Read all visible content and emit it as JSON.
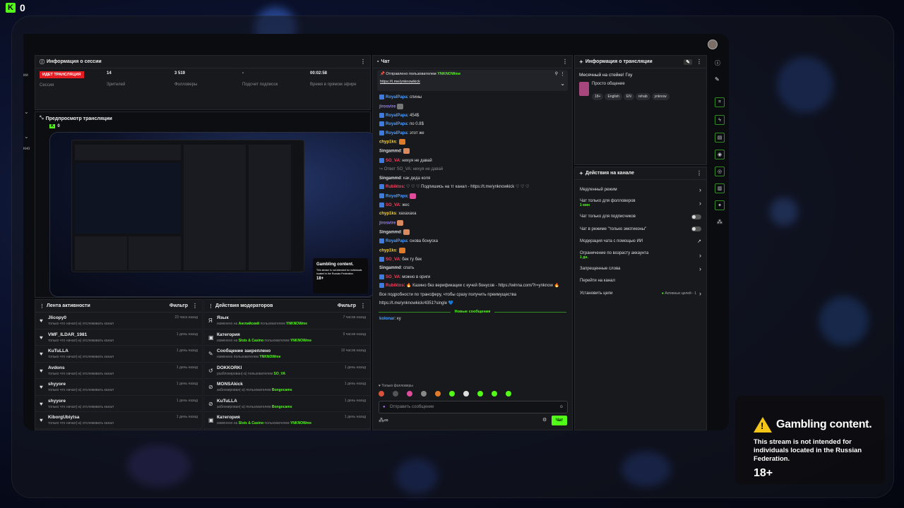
{
  "topbar": {
    "logo_letter": "K",
    "viewer_count": "0"
  },
  "session": {
    "title": "Информация о сессии",
    "status_badge": "ИДЕТ ТРАНСЛЯЦИЯ",
    "session_label": "Сессия",
    "viewers": "14",
    "viewers_label": "Зрителей",
    "followers": "3 519",
    "followers_label": "Фолловеры",
    "subs": "-",
    "subs_label": "Подсчет подписок",
    "uptime": "00:02:58",
    "uptime_label": "Время в прямом эфире"
  },
  "preview": {
    "title": "Предпросмотр трансляции",
    "logo": "K",
    "count": "0",
    "overlay_title": "Gambling content.",
    "overlay_desc": "This stream is not intended for individuals located in the Russian Federation.",
    "overlay_age": "18+"
  },
  "activity": {
    "title": "Лента активности",
    "filter": "Фильтр",
    "items": [
      {
        "name": "Jlicopy0",
        "sub": "только что начал(-а) отслеживать канал",
        "time": "23 часа назад"
      },
      {
        "name": "VMF_ILDAR_1981",
        "sub": "только что начал(-а) отслеживать канал",
        "time": "1 день назад"
      },
      {
        "name": "KuTuLLA",
        "sub": "только что начал(-а) отслеживать канал",
        "time": "1 день назад"
      },
      {
        "name": "Avdons",
        "sub": "только что начал(-а) отслеживать канал",
        "time": "1 день назад"
      },
      {
        "name": "shyyore",
        "sub": "только что начал(-а) отслеживать канал",
        "time": "1 день назад"
      },
      {
        "name": "shyyore",
        "sub": "только что начал(-а) отслеживать канал",
        "time": "1 день назад"
      },
      {
        "name": "KiborgUbiytsa",
        "sub": "только что начал(-а) отслеживать канал",
        "time": "1 день назад"
      }
    ]
  },
  "modactions": {
    "title": "Действия модераторов",
    "filter": "Фильтр",
    "items": [
      {
        "icon": "Я",
        "name": "Язык",
        "pre": "изменено на ",
        "hl1": "Английский",
        "mid": " пользователем ",
        "hl2": "YNKNOWme",
        "time": "7 часов назад"
      },
      {
        "icon": "▣",
        "name": "Категория",
        "pre": "изменено на ",
        "hl1": "Slots & Casino",
        "mid": " пользователем ",
        "hl2": "YNKNOWme",
        "time": "9 часов назад"
      },
      {
        "icon": "✎",
        "name": "Сообщение закреплено",
        "pre": "",
        "hl1": "",
        "mid": "изменено пользователем ",
        "hl2": "YNKNOWme",
        "time": "10 часов назад"
      },
      {
        "icon": "↺",
        "name": "DOKKORKI",
        "pre": "",
        "hl1": "",
        "mid": "разблокирован(-а) пользователем ",
        "hl2": "SO_VA",
        "time": "1 день назад"
      },
      {
        "icon": "⊘",
        "name": "MONSAkick",
        "pre": "",
        "hl1": "",
        "mid": "заблокирован(-а) пользователем ",
        "hl2": "Bongocams",
        "time": "1 день назад"
      },
      {
        "icon": "⊘",
        "name": "KuTuLLA",
        "pre": "",
        "hl1": "",
        "mid": "заблокирован(-а) пользователем ",
        "hl2": "Bongocams",
        "time": "1 день назад"
      },
      {
        "icon": "▣",
        "name": "Категория",
        "pre": "изменено на ",
        "hl1": "Slots & Casino",
        "mid": " пользователем ",
        "hl2": "YNKNOWme",
        "time": "1 день назад"
      }
    ]
  },
  "chat": {
    "title": "Чат",
    "pinned_by": "Отправлено пользователем",
    "pinned_user": "YNKNOWme",
    "pinned_link": "https://t.me/ynknowkick",
    "lines": [
      {
        "user": "RoyalPapa",
        "color": "#4c9dff",
        "text": ": спины",
        "badge": true
      },
      {
        "user": "jirosvire",
        "color": "#9b7bff",
        "text": "",
        "badge": false,
        "emote": "#777"
      },
      {
        "user": "RoyalPapa",
        "color": "#4c9dff",
        "text": ": 454$",
        "badge": true
      },
      {
        "user": "RoyalPapa",
        "color": "#4c9dff",
        "text": ": по 0.8$",
        "badge": true
      },
      {
        "user": "RoyalPapa",
        "color": "#4c9dff",
        "text": ": этот же",
        "badge": true
      },
      {
        "user": "chyp1ks",
        "color": "#f5d142",
        "text": ":",
        "badge": false,
        "emote": "#e07b2a"
      },
      {
        "user": "Singammd",
        "color": "#dddddd",
        "text": ":",
        "badge": false,
        "emote": "#d98a5f"
      },
      {
        "user": "SO_VA",
        "color": "#ff3b5c",
        "text": ": нихуя не давай",
        "badge": true
      },
      {
        "user": "",
        "color": "#888",
        "text": "↪ Ответ SO_VA: нихуя не давай",
        "badge": false
      },
      {
        "user": "Singammd",
        "color": "#dddddd",
        "text": ": как деда коля",
        "badge": false
      },
      {
        "user": "Rubiktos",
        "color": "#ff3b5c",
        "text": ": ♡ ♡ ♡ Подпишись на тг канал - https://t.me/ynknowkick ♡ ♡ ♡",
        "badge": true
      },
      {
        "user": "RoyalPapa",
        "color": "#4c9dff",
        "text": ":",
        "badge": true,
        "emote": "#e04c9c"
      },
      {
        "user": "SO_VA",
        "color": "#ff3b5c",
        "text": ": жес",
        "badge": true
      },
      {
        "user": "chyp1ks",
        "color": "#f5d142",
        "text": ": хахахаха",
        "badge": false
      },
      {
        "user": "jirosvire",
        "color": "#9b7bff",
        "text": "",
        "badge": false,
        "emote": "#d98a5f"
      },
      {
        "user": "Singammd",
        "color": "#dddddd",
        "text": ":",
        "badge": false,
        "emote": "#d98a5f"
      },
      {
        "user": "RoyalPapa",
        "color": "#4c9dff",
        "text": ": снова бонуска",
        "badge": true
      },
      {
        "user": "chyp1ks",
        "color": "#f5d142",
        "text": ":",
        "badge": false,
        "emote": "#e07b2a"
      },
      {
        "user": "SO_VA",
        "color": "#ff3b5c",
        "text": ": бек ту бек",
        "badge": true
      },
      {
        "user": "Singammd",
        "color": "#dddddd",
        "text": ": спать",
        "badge": false
      },
      {
        "user": "SO_VA",
        "color": "#ff3b5c",
        "text": ": можно в ориги",
        "badge": true
      },
      {
        "user": "Rubiktos",
        "color": "#ff3b5c",
        "text": ": 🔥 Казино без верификации с кучей бонусов - https://winna.com/?r=ynknow 🔥",
        "badge": true
      },
      {
        "user": "",
        "color": "#ddd",
        "text": "Все подробности по трансферу, чтобы сразу получить преимущества",
        "badge": false
      },
      {
        "user": "",
        "color": "#ddd",
        "text": "https://t.me/ynknowkick/4351?single 💙",
        "badge": false
      }
    ],
    "new_messages": "Новые сообщения",
    "last_user": "kolonar",
    "last_text": ": ку",
    "followers_only": "Только фолловеры",
    "input_placeholder": "Отправить сообщение",
    "infinity": "∞",
    "send": "Чат"
  },
  "stream_info": {
    "title": "Информация о трансляции",
    "stream_title": "Месячный на стейке! Гоу",
    "category": "Просто общение",
    "tags": [
      "18+",
      "English",
      "EN",
      "rehab",
      "ynknow"
    ]
  },
  "channel_actions": {
    "title": "Действия на канале",
    "items": [
      {
        "label": "Медленный режим",
        "sub": "",
        "ctl": "chev"
      },
      {
        "label": "Чат только для фолловеров",
        "sub": "1 мин",
        "ctl": "chev"
      },
      {
        "label": "Чат только для подписчиков",
        "sub": "",
        "ctl": "toggle"
      },
      {
        "label": "Чат в режиме \"только эмотиконы\"",
        "sub": "",
        "ctl": "toggle"
      },
      {
        "label": "Модерация чата с помощью ИИ",
        "sub": "",
        "ctl": "ext"
      },
      {
        "label": "Ограничение по возрасту аккаунта",
        "sub": "1 дн.",
        "ctl": "chev"
      },
      {
        "label": "Запрещенные слова",
        "sub": "",
        "ctl": "chev"
      },
      {
        "label": "Перейти на канал",
        "sub": "",
        "ctl": "none"
      },
      {
        "label": "Установить цели",
        "sub": "",
        "ctl": "goal",
        "goal": "Активных целей - 1"
      }
    ]
  },
  "gambling": {
    "title": "Gambling content.",
    "desc": "This stream is not intended for individuals located in the Russian Federation.",
    "age": "18+"
  }
}
